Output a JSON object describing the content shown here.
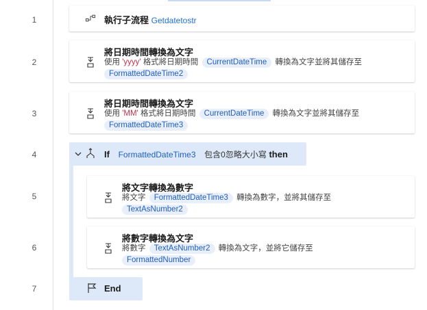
{
  "rows": [
    {
      "line": "1"
    },
    {
      "line": "2"
    },
    {
      "line": "3"
    },
    {
      "line": "4"
    },
    {
      "line": "5"
    },
    {
      "line": "6"
    },
    {
      "line": "7"
    }
  ],
  "step1": {
    "title": "執行子流程",
    "subflow": "Getdatetostr",
    "icon": "subflow-icon"
  },
  "step2": {
    "title": "將日期時間轉換為文字",
    "d_use": "使用",
    "d_format": "'yyyy'",
    "d_mid": "格式將日期時間",
    "var_in": "CurrentDateTime",
    "d_tail": "轉換為文字並將其儲存至",
    "var_out": "FormattedDateTime2",
    "icon": "convert-icon"
  },
  "step3": {
    "title": "將日期時間轉換為文字",
    "d_use": "使用",
    "d_format": "'MM'",
    "d_mid": "格式將日期時間",
    "var_in": "CurrentDateTime",
    "d_tail": "轉換為文字並將其儲存至",
    "var_out": "FormattedDateTime3",
    "icon": "convert-icon"
  },
  "step4": {
    "keyword_if": "If",
    "var": "FormattedDateTime3",
    "condition": "包含0忽略大小寫",
    "keyword_then": "then",
    "icon": "if-branch-icon"
  },
  "step5": {
    "title": "將文字轉換為數字",
    "d_pre": "將文字",
    "var_in": "FormattedDateTime3",
    "d_tail": "轉換為數字，並將其儲存至",
    "var_out": "TextAsNumber2",
    "icon": "convert-icon"
  },
  "step6": {
    "title": "將數字轉換為文字",
    "d_pre": "將數字",
    "var_in": "TextAsNumber2",
    "d_tail": "轉換為文字，並將它儲存至",
    "var_out": "FormattedNumber",
    "icon": "convert-icon"
  },
  "step7": {
    "label": "End",
    "icon": "flag-icon"
  },
  "colors": {
    "variable_bg": "#e8effa",
    "variable_text": "#1f5fbf",
    "block_highlight": "#dde8f8",
    "format_literal": "#c4314b"
  }
}
